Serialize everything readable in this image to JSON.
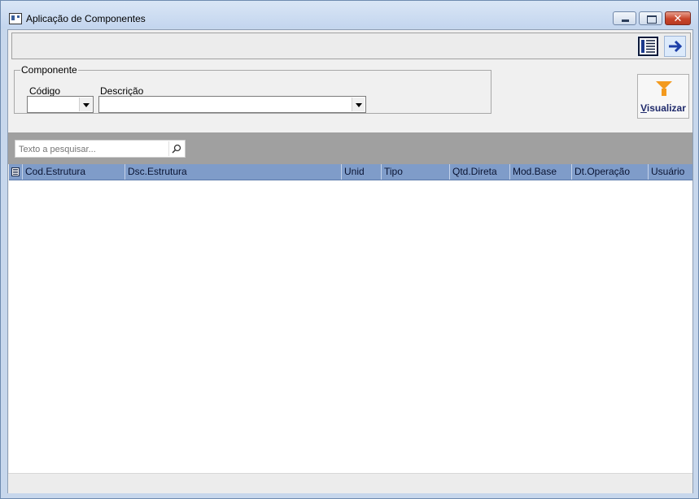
{
  "window": {
    "title": "Aplicação de Componentes",
    "close_label": "✕"
  },
  "toolbar": {
    "grid_icon": "grid-view-icon",
    "arrow_icon": "arrow-right-icon"
  },
  "filter": {
    "group_label": "Componente",
    "codigo_label": "Código",
    "codigo_value": "",
    "descricao_label": "Descrição",
    "descricao_value": ""
  },
  "visualizar": {
    "label_first": "V",
    "label_rest": "isualizar",
    "icon": "funnel-icon",
    "icon_color": "#f39a1e"
  },
  "search": {
    "placeholder": "Texto a pesquisar...",
    "value": ""
  },
  "grid": {
    "header_color": "#7f9cc9",
    "columns": [
      "Cod.Estrutura",
      "Dsc.Estrutura",
      "Unid",
      "Tipo",
      "Qtd.Direta",
      "Mod.Base",
      "Dt.Operação",
      "Usuário"
    ],
    "rows": []
  }
}
